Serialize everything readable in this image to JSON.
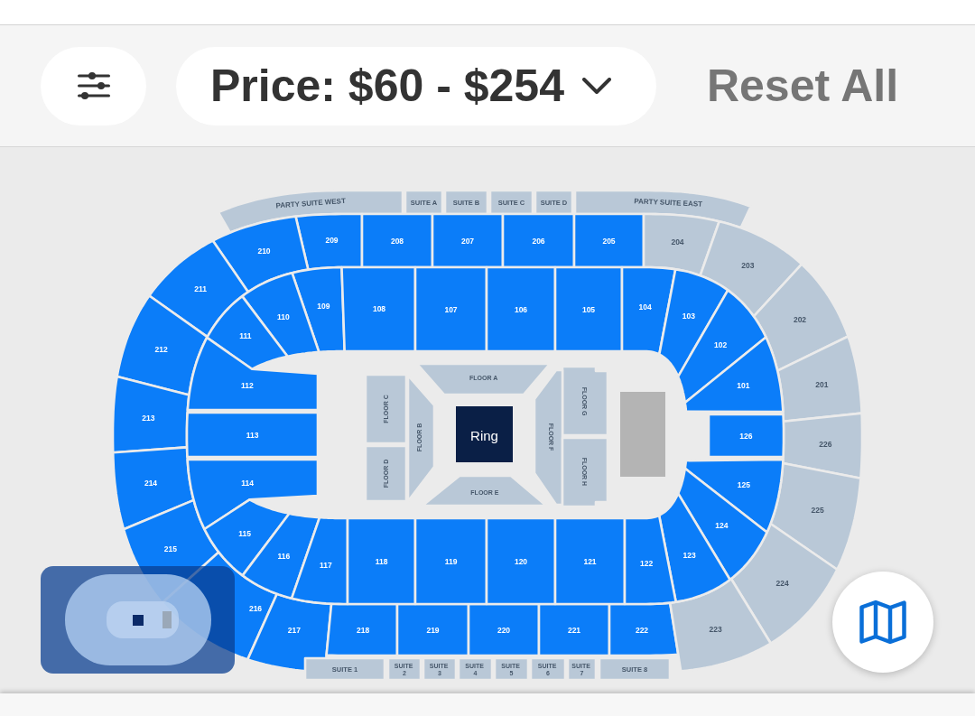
{
  "filter_bar": {
    "price_dropdown": {
      "label": "Price: $60 - $254"
    },
    "reset_button": {
      "label": "Reset All"
    }
  },
  "map": {
    "stage": {
      "label": "Ring"
    },
    "suites_top": [
      {
        "label": "PARTY SUITE WEST",
        "available": false
      },
      {
        "label": "SUITE A",
        "available": false
      },
      {
        "label": "SUITE B",
        "available": false
      },
      {
        "label": "SUITE C",
        "available": false
      },
      {
        "label": "SUITE D",
        "available": false
      },
      {
        "label": "PARTY SUITE EAST",
        "available": false
      }
    ],
    "level_200": [
      {
        "label": "209",
        "available": true
      },
      {
        "label": "208",
        "available": true
      },
      {
        "label": "207",
        "available": true
      },
      {
        "label": "206",
        "available": true
      },
      {
        "label": "205",
        "available": true
      },
      {
        "label": "204",
        "available": false
      },
      {
        "label": "210",
        "available": true
      },
      {
        "label": "203",
        "available": false
      },
      {
        "label": "211",
        "available": true
      },
      {
        "label": "202",
        "available": false
      },
      {
        "label": "212",
        "available": true
      },
      {
        "label": "201",
        "available": false
      },
      {
        "label": "213",
        "available": true
      },
      {
        "label": "226",
        "available": false
      },
      {
        "label": "214",
        "available": true
      },
      {
        "label": "225",
        "available": false
      },
      {
        "label": "215",
        "available": true
      },
      {
        "label": "216",
        "available": true
      },
      {
        "label": "224",
        "available": false
      },
      {
        "label": "217",
        "available": true
      },
      {
        "label": "218",
        "available": true
      },
      {
        "label": "219",
        "available": true
      },
      {
        "label": "220",
        "available": true
      },
      {
        "label": "221",
        "available": true
      },
      {
        "label": "222",
        "available": true
      },
      {
        "label": "223",
        "available": false
      }
    ],
    "level_100": [
      {
        "label": "109",
        "available": true
      },
      {
        "label": "108",
        "available": true
      },
      {
        "label": "107",
        "available": true
      },
      {
        "label": "106",
        "available": true
      },
      {
        "label": "105",
        "available": true
      },
      {
        "label": "104",
        "available": true
      },
      {
        "label": "110",
        "available": true
      },
      {
        "label": "103",
        "available": true
      },
      {
        "label": "111",
        "available": true
      },
      {
        "label": "102",
        "available": true
      },
      {
        "label": "112",
        "available": true
      },
      {
        "label": "101",
        "available": true
      },
      {
        "label": "113",
        "available": true
      },
      {
        "label": "126",
        "available": true
      },
      {
        "label": "114",
        "available": true
      },
      {
        "label": "125",
        "available": true
      },
      {
        "label": "124",
        "available": true
      },
      {
        "label": "115",
        "available": true
      },
      {
        "label": "116",
        "available": true
      },
      {
        "label": "123",
        "available": true
      },
      {
        "label": "117",
        "available": true
      },
      {
        "label": "118",
        "available": true
      },
      {
        "label": "119",
        "available": true
      },
      {
        "label": "120",
        "available": true
      },
      {
        "label": "121",
        "available": true
      },
      {
        "label": "122",
        "available": true
      }
    ],
    "floor": [
      {
        "label": "FLOOR A",
        "available": false
      },
      {
        "label": "FLOOR C",
        "available": false
      },
      {
        "label": "FLOOR G",
        "available": false
      },
      {
        "label": "FLOOR B",
        "available": false
      },
      {
        "label": "FLOOR F",
        "available": false
      },
      {
        "label": "FLOOR D",
        "available": false
      },
      {
        "label": "FLOOR H",
        "available": false
      },
      {
        "label": "FLOOR E",
        "available": false
      }
    ],
    "suites_bottom": [
      {
        "label": "SUITE 1",
        "available": false
      },
      {
        "label": "SUITE 2",
        "available": false
      },
      {
        "label": "SUITE 3",
        "available": false
      },
      {
        "label": "SUITE 4",
        "available": false
      },
      {
        "label": "SUITE 5",
        "available": false
      },
      {
        "label": "SUITE 6",
        "available": false
      },
      {
        "label": "SUITE 7",
        "available": false
      },
      {
        "label": "SUITE 8",
        "available": false
      }
    ]
  }
}
